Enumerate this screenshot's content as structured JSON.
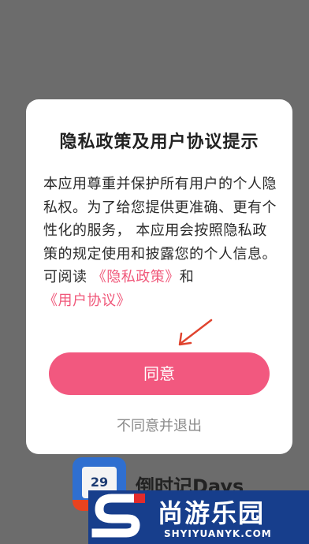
{
  "background_app": {
    "icon_label": "29",
    "name": "倒时记Days"
  },
  "dialog": {
    "title": "隐私政策及用户协议提示",
    "body": "本应用尊重并保护所有用户的个人隐私权。为了给您提供更准确、更有个性化的服务， 本应用会按照隐私政策的规定使用和披露您的个人信息。",
    "read_prefix": "可阅读 ",
    "privacy_link": "《隐私政策》",
    "conjunction": "和",
    "agreement_link": "《用户协议》",
    "agree_button": "同意",
    "decline_link": "不同意并退出"
  },
  "watermark": {
    "name": "尚游乐园",
    "url": "SHYIYUANYK.COM"
  },
  "colors": {
    "accent": "#f2587f",
    "link": "#f0587a",
    "overlay": "#6c6c6c",
    "watermark_bg": "#173e8c"
  }
}
